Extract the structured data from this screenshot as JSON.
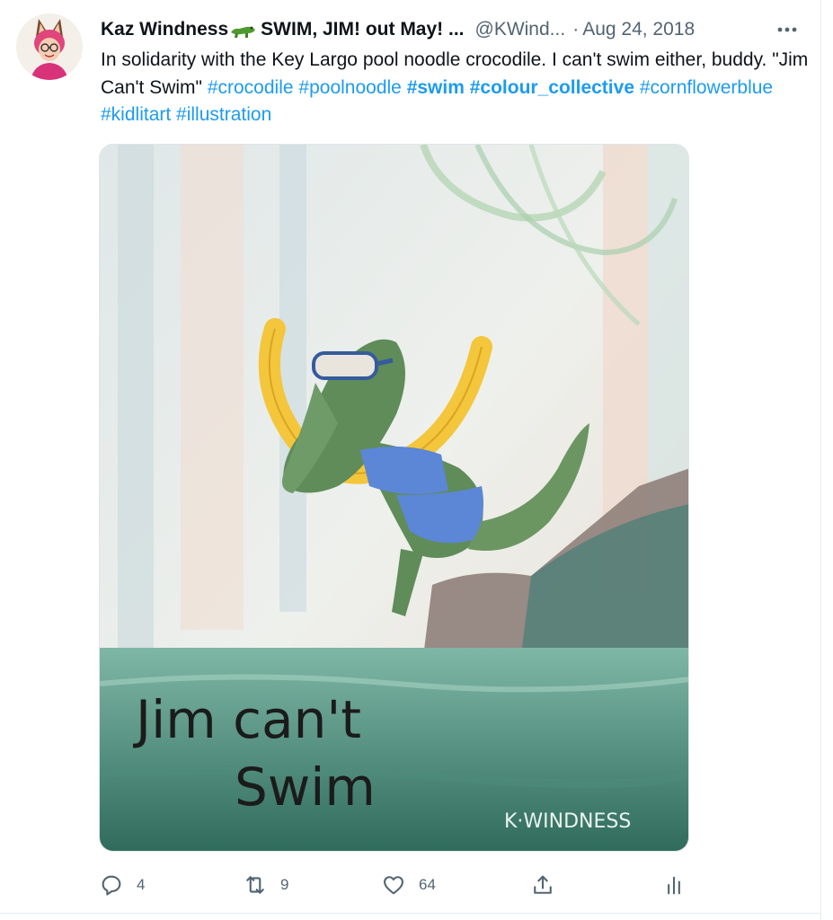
{
  "tweet": {
    "display_name": "Kaz Windness",
    "name_suffix": " SWIM, JIM! out May! ...",
    "name_emoji_icon": "crocodile-emoji-icon",
    "handle": "@KWind...",
    "separator": "·",
    "date": "Aug 24, 2018",
    "more_icon": "more-horizontal-icon",
    "text_parts": {
      "t1": "In solidarity with the Key Largo pool noodle crocodile. I can't swim either, buddy. \"Jim Can't Swim\" ",
      "h1": "#crocodile",
      "s1": " ",
      "h2": "#poolnoodle",
      "s2": " ",
      "h3": "#swim",
      "s3": " ",
      "h4": "#colour_collective",
      "s4": " ",
      "h5": "#cornflowerblue",
      "s5": " ",
      "h6": "#kidlitart",
      "s6": " ",
      "h7": "#illustration"
    },
    "image": {
      "caption_line1": "Jim can't",
      "caption_line2": "Swim",
      "signature": "K·WINDNESS"
    },
    "actions": {
      "reply": {
        "icon": "reply-icon",
        "count": "4"
      },
      "retweet": {
        "icon": "retweet-icon",
        "count": "9"
      },
      "like": {
        "icon": "heart-icon",
        "count": "64"
      },
      "share": {
        "icon": "share-icon"
      },
      "analytics": {
        "icon": "analytics-icon"
      }
    },
    "colors": {
      "link": "#1d9bf0",
      "text": "#0f1419",
      "secondary": "#536471"
    }
  }
}
